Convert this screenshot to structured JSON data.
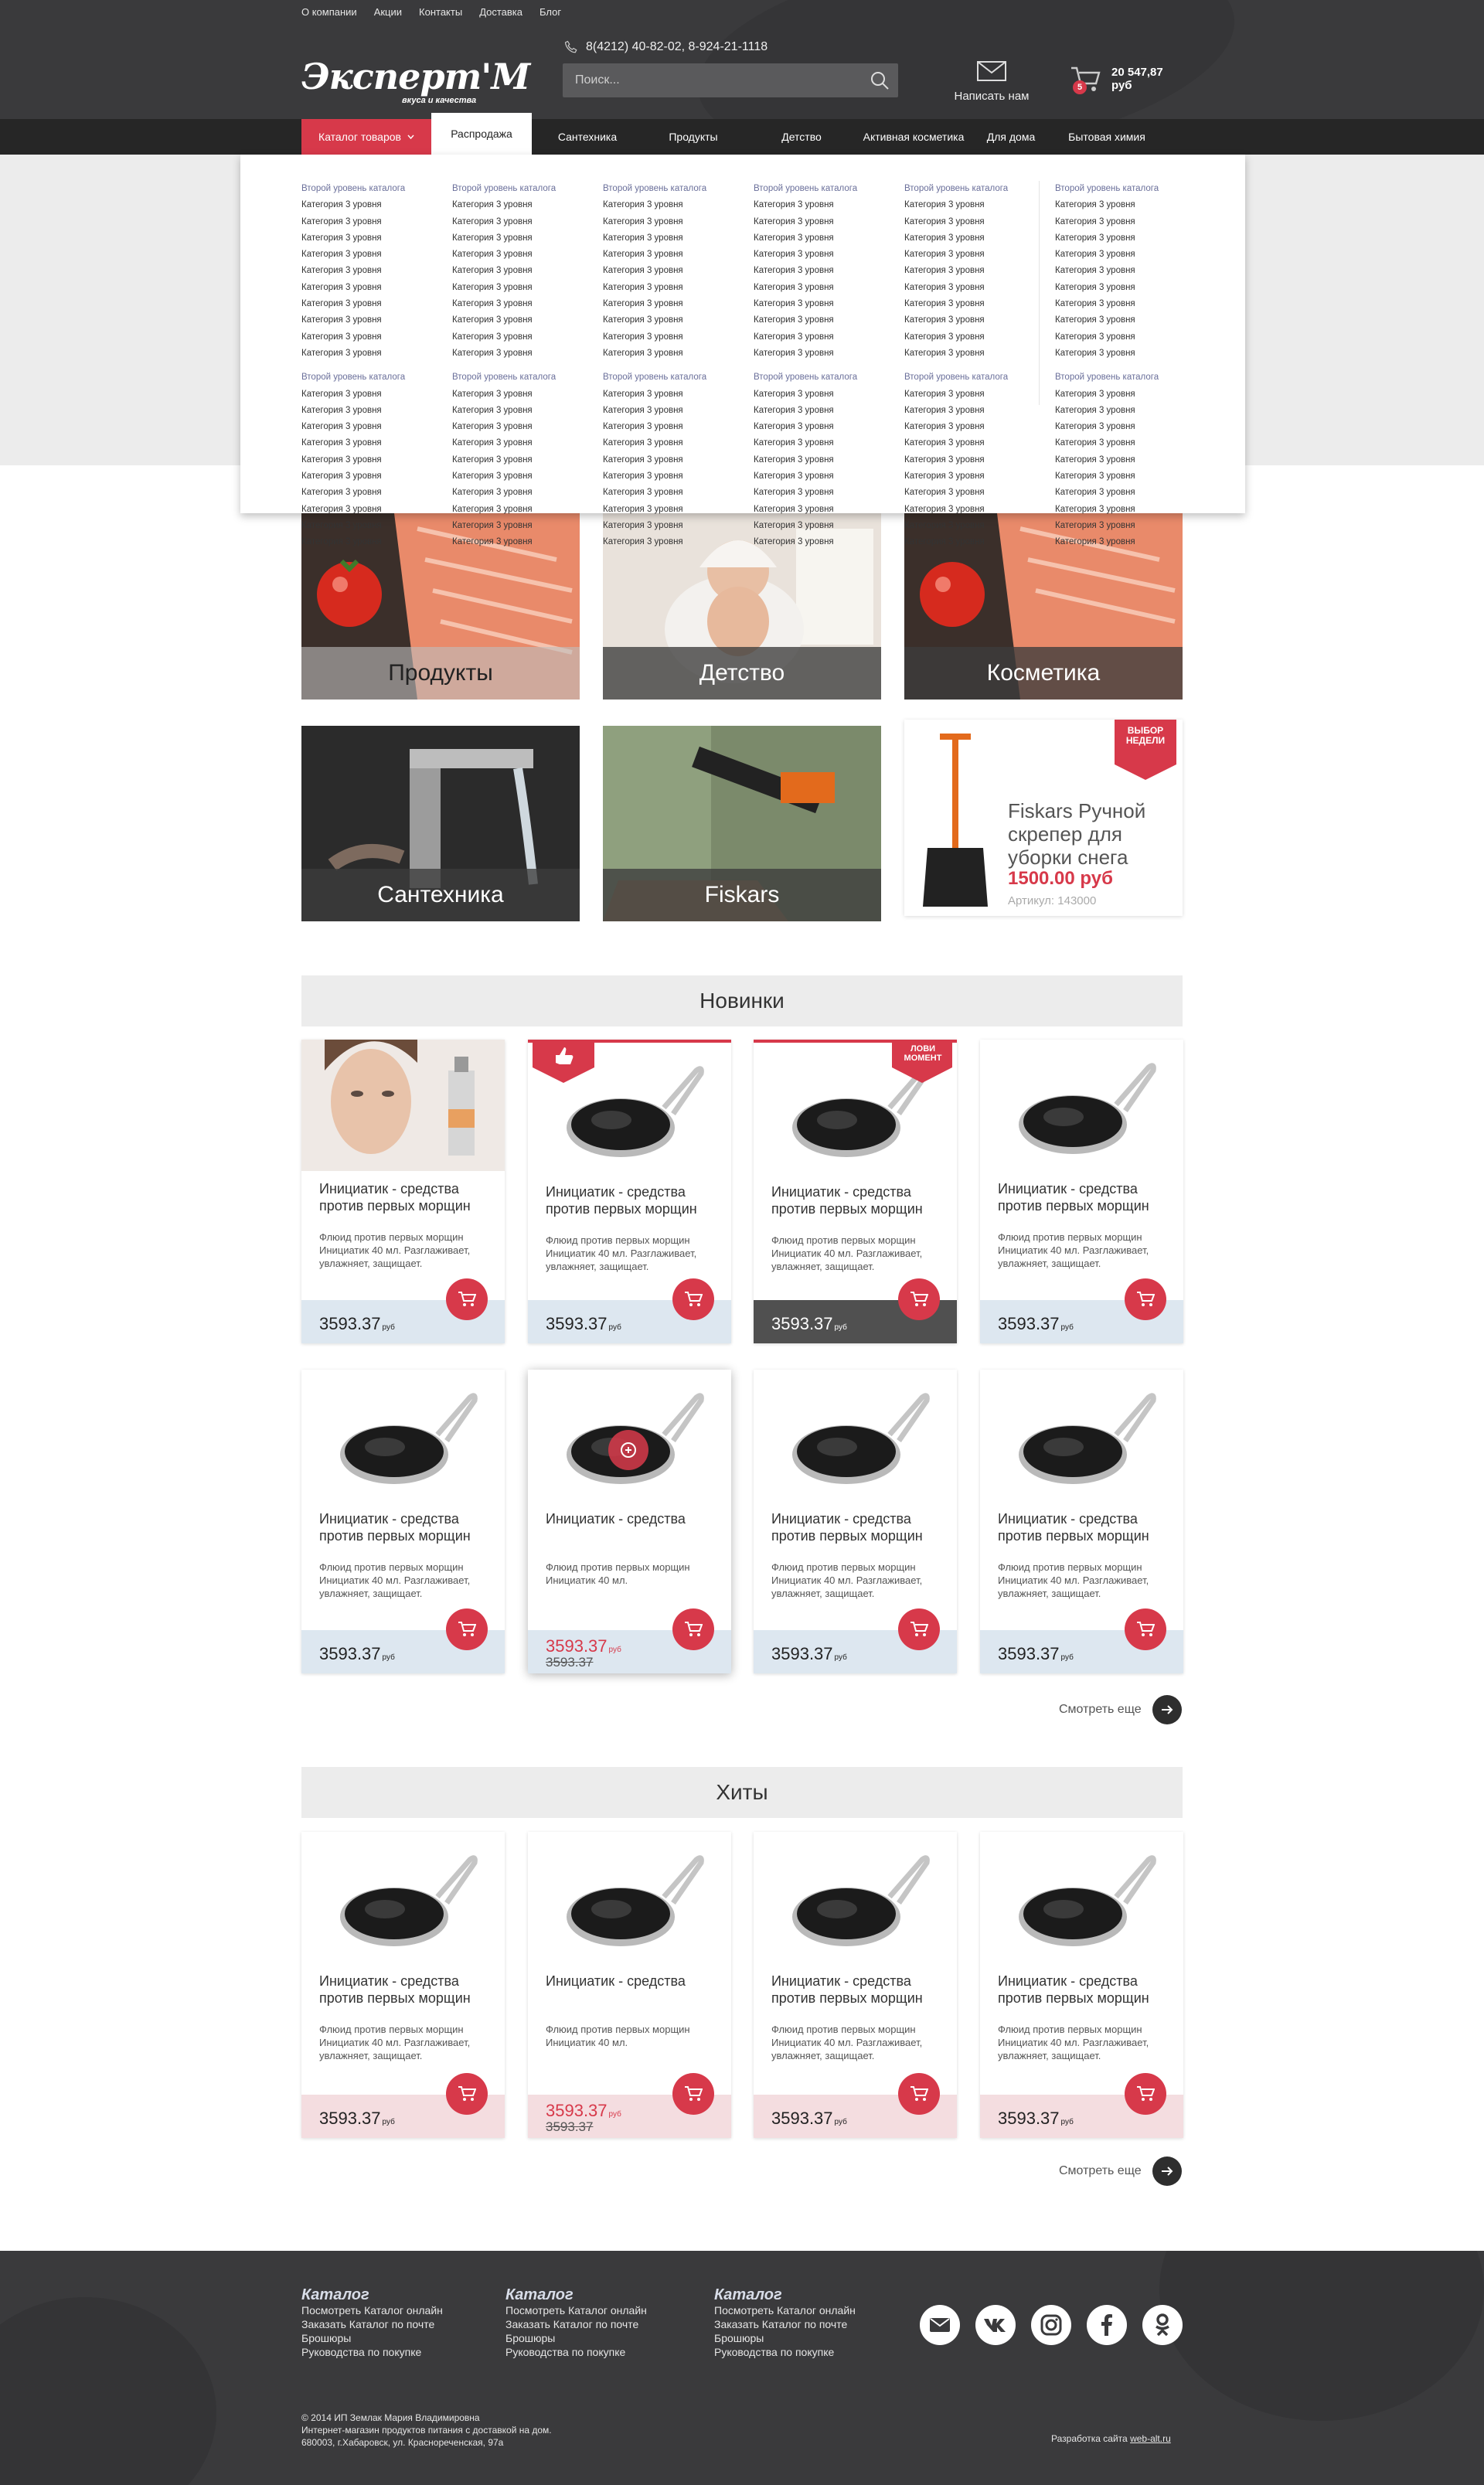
{
  "topnav": [
    "О компании",
    "Акции",
    "Контакты",
    "Доставка",
    "Блог"
  ],
  "logo": {
    "word": "Эксперт'М",
    "tagline": "вкуса и качества"
  },
  "phone": "8(4212) 40-82-02, 8-924-21-1118",
  "search": {
    "placeholder": "Поиск..."
  },
  "mail_label": "Написать нам",
  "cart": {
    "count": "5",
    "total": "20 547,87 руб"
  },
  "menu": {
    "catalog": "Каталог товаров",
    "items": [
      "Распродажа",
      "Сантехника",
      "Продукты",
      "Детство",
      "Активная косметика",
      "Для дома",
      "Бытовая химия"
    ]
  },
  "dropdown": {
    "heading": "Второй уровень каталога",
    "item": "Категория 3 уровня"
  },
  "tiles": [
    "Продукты",
    "Детство",
    "Косметика",
    "Сантехника",
    "Fiskars"
  ],
  "week": {
    "flag": "ВЫБОР НЕДЕЛИ",
    "title": "Fiskars Ручной скрепер для уборки снега",
    "price": "1500.00 руб",
    "sku": "Артикул: 143000"
  },
  "sections": {
    "new": "Новинки",
    "hits": "Хиты",
    "more": "Смотреть еще"
  },
  "product": {
    "title": "Инициатик - средства против первых морщин",
    "short_title": "Инициатик - средства",
    "desc": "Флюид против первых морщин Инициатик 40 мл. Разглаживает, увлажняет, защищает.",
    "short_desc": "Флюид против первых морщин Инициатик 40 мл.",
    "price": "3593.37",
    "currency": "руб",
    "flag_moment": "ЛОВИ МОМЕНТ"
  },
  "footer": {
    "cols": [
      {
        "title": "Каталог",
        "links": [
          "Посмотреть Каталог онлайн",
          "Заказать Каталог по почте",
          "Брошюры",
          "Руководства по покупке"
        ]
      },
      {
        "title": "Каталог",
        "links": [
          "Посмотреть Каталог онлайн",
          "Заказать Каталог по почте",
          "Брошюры",
          "Руководства по покупке"
        ]
      },
      {
        "title": "Каталог",
        "links": [
          "Посмотреть Каталог онлайн",
          "Заказать Каталог по почте",
          "Брошюры",
          "Руководства по покупке"
        ]
      }
    ],
    "copyright": [
      "© 2014 ИП Землак Мария Владимировна",
      "Интернет-магазин продуктов питания с доставкой на дом.",
      "680003, г.Хабаровск, ул. Краснореченская, 97а"
    ],
    "dev_label": "Разработка сайта",
    "dev_link": "web-alt.ru"
  },
  "colors": {
    "accent": "#d7394a",
    "dark": "#3a3a3c",
    "menubar": "#262626",
    "price_bg": "#dde7f0"
  }
}
